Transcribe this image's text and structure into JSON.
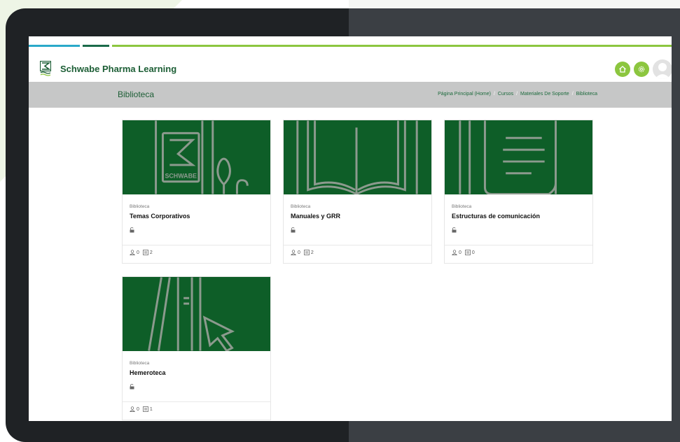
{
  "app": {
    "brand": "Schwabe Pharma Learning",
    "accent_color": "#8cc63f",
    "brand_green": "#1c5e35",
    "thumb_green": "#0e5e28"
  },
  "navbar": {
    "icons": [
      "home-icon",
      "gear-icon"
    ],
    "avatar": "avatar-icon"
  },
  "header": {
    "title": "Biblioteca",
    "breadcrumb": [
      {
        "label": "Página Principal (Home)"
      },
      {
        "label": "Cursos"
      },
      {
        "label": "Materiales De Soporte"
      },
      {
        "label": "Biblioteca"
      }
    ]
  },
  "cards": [
    {
      "category": "Biblioteca",
      "title": "Temas Corporativos",
      "users": "0",
      "items": "2",
      "image_text": "SCHWABE"
    },
    {
      "category": "Biblioteca",
      "title": "Manuales y GRR",
      "users": "0",
      "items": "2"
    },
    {
      "category": "Biblioteca",
      "title": "Estructuras de comunicación",
      "users": "0",
      "items": "0"
    },
    {
      "category": "Biblioteca",
      "title": "Hemeroteca",
      "users": "0",
      "items": "1"
    }
  ]
}
